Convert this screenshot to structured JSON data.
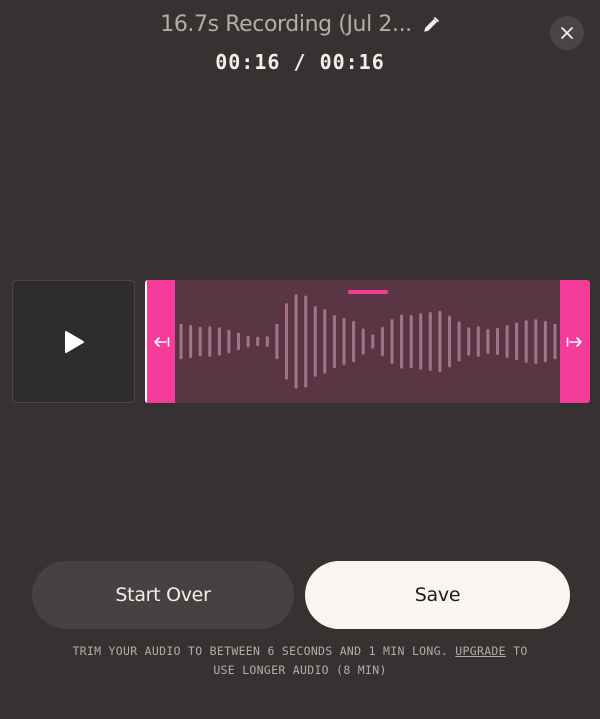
{
  "recording": {
    "title": "16.7s Recording (Jul 2...",
    "current_time": "00:16",
    "separator": " / ",
    "total_time": "00:16"
  },
  "icons": {
    "edit": "pencil-icon",
    "close": "close-icon",
    "play": "play-icon",
    "trim_left": "trim-left-arrow-icon",
    "trim_right": "trim-right-arrow-icon"
  },
  "colors": {
    "background": "#363232",
    "accent": "#f53c9a",
    "selection": "#5a3645",
    "waveform": "#a57488"
  },
  "waveform": {
    "amplitudes": [
      0.3,
      0.28,
      0.25,
      0.26,
      0.24,
      0.2,
      0.15,
      0.1,
      0.08,
      0.09,
      0.3,
      0.65,
      0.8,
      0.78,
      0.6,
      0.55,
      0.45,
      0.4,
      0.35,
      0.22,
      0.12,
      0.25,
      0.38,
      0.46,
      0.45,
      0.48,
      0.5,
      0.52,
      0.44,
      0.34,
      0.24,
      0.26,
      0.21,
      0.23,
      0.28,
      0.32,
      0.36,
      0.38,
      0.35,
      0.3
    ]
  },
  "buttons": {
    "start_over": "Start Over",
    "save": "Save"
  },
  "note": {
    "text_before": "TRIM YOUR AUDIO TO BETWEEN 6 SECONDS AND 1 MIN LONG. ",
    "link": "UPGRADE",
    "text_after_1": " TO",
    "text_after_2": "USE LONGER AUDIO (8 MIN)"
  }
}
